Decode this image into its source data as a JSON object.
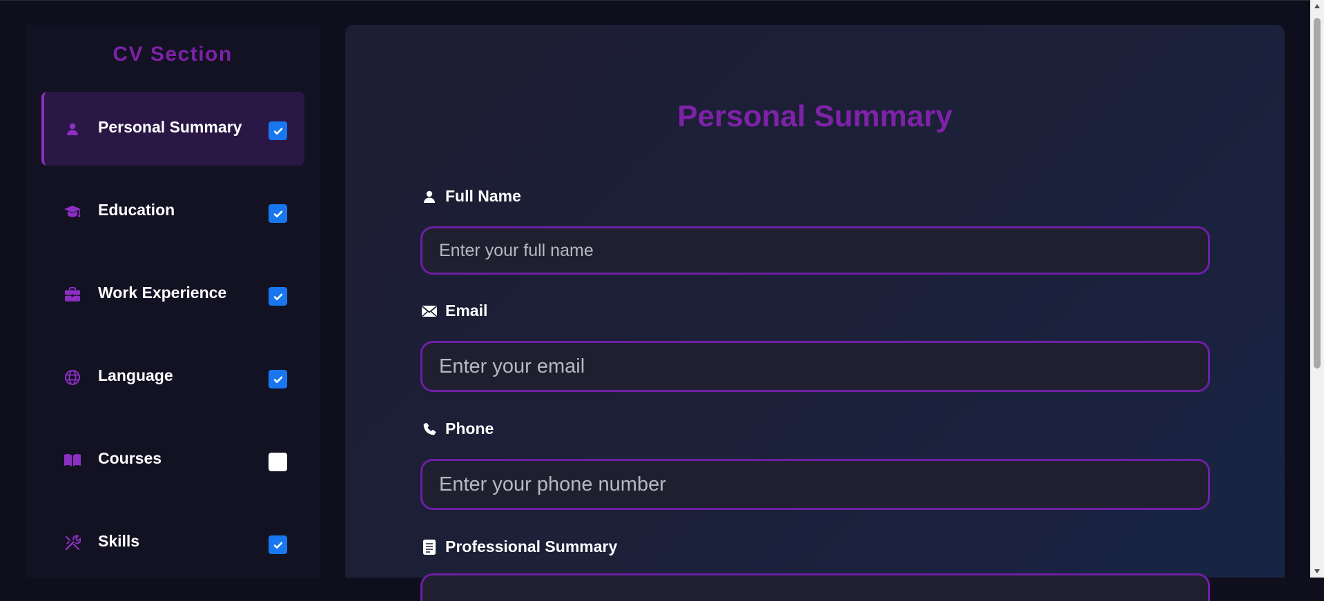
{
  "sidebar": {
    "title": "CV Section",
    "items": [
      {
        "label": "Personal Summary",
        "icon": "user-icon",
        "checked": true,
        "active": true
      },
      {
        "label": "Education",
        "icon": "graduation-cap-icon",
        "checked": true,
        "active": false
      },
      {
        "label": "Work Experience",
        "icon": "briefcase-icon",
        "checked": true,
        "active": false
      },
      {
        "label": "Language",
        "icon": "globe-icon",
        "checked": true,
        "active": false
      },
      {
        "label": "Courses",
        "icon": "book-icon",
        "checked": false,
        "active": false
      },
      {
        "label": "Skills",
        "icon": "tools-icon",
        "checked": true,
        "active": false
      }
    ]
  },
  "main": {
    "title": "Personal Summary",
    "fields": {
      "full_name": {
        "label": "Full Name",
        "icon": "user-icon",
        "value": "",
        "placeholder": "Enter your full name"
      },
      "email": {
        "label": "Email",
        "icon": "envelope-icon",
        "value": "",
        "placeholder": "Enter your email"
      },
      "phone": {
        "label": "Phone",
        "icon": "phone-icon",
        "value": "",
        "placeholder": "Enter your phone number"
      },
      "summary": {
        "label": "Professional Summary",
        "icon": "document-icon"
      }
    }
  },
  "colors": {
    "accent": "#7e22a8",
    "checkbox": "#1877ee",
    "background": "#0f0e1c",
    "sidebar_bg": "#121223",
    "active_item_bg": "#2a1745",
    "input_border": "#6e1fa6"
  }
}
